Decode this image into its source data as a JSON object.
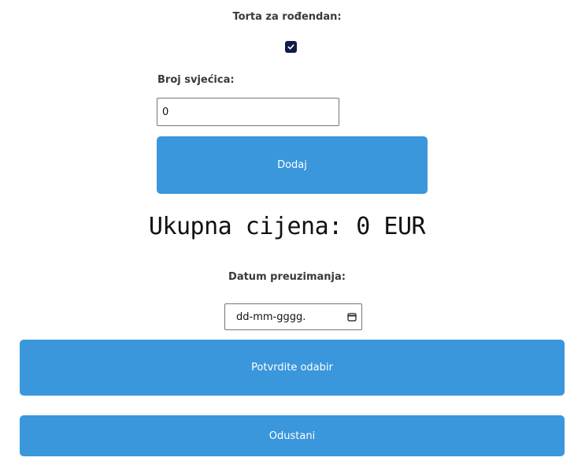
{
  "cake": {
    "label": "Torta za rođendan:",
    "checked": true
  },
  "candles": {
    "label": "Broj svjećica:",
    "value": "0"
  },
  "add_button": {
    "label": "Dodaj"
  },
  "total": {
    "text": "Ukupna cijena: 0 EUR"
  },
  "pickup_date": {
    "label": "Datum preuzimanja:",
    "placeholder": "dd-mm-gggg."
  },
  "confirm_button": {
    "label": "Potvrdite odabir"
  },
  "cancel_button": {
    "label": "Odustani"
  },
  "colors": {
    "button_bg": "#3a97dc",
    "checkbox_bg": "#0f1b4a"
  }
}
